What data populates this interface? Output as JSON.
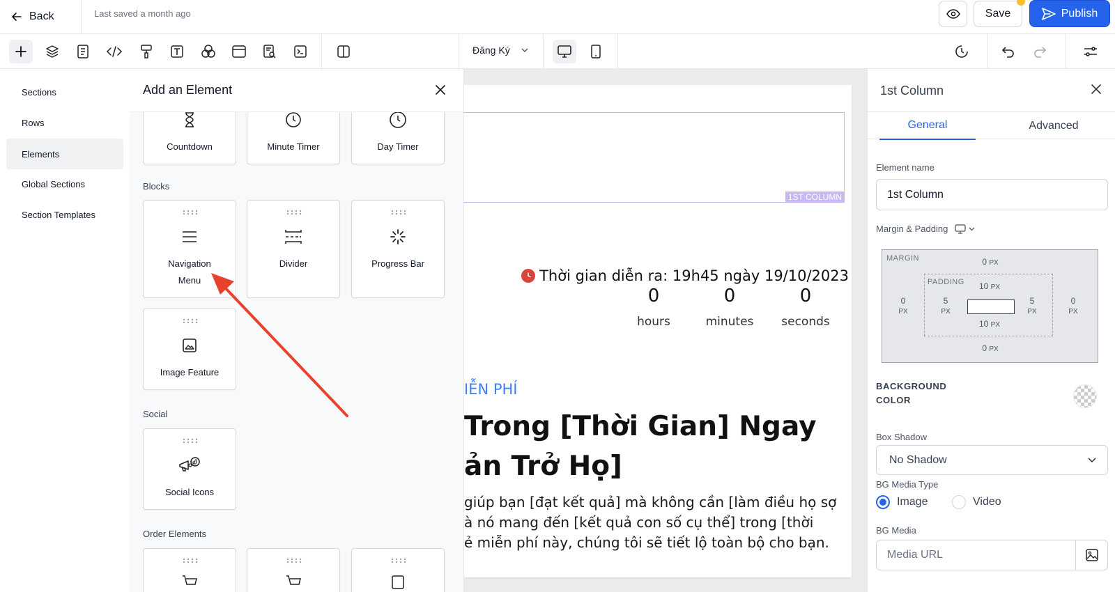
{
  "topbar": {
    "back_label": "Back",
    "last_saved": "Last saved a month ago",
    "save_label": "Save",
    "publish_label": "Publish",
    "colors": {
      "publish": "#2563eb",
      "notify": "#fbbf24"
    }
  },
  "toolbar": {
    "page_name": "Đăng Ký",
    "icons": [
      "plus-icon",
      "layers-icon",
      "page-icon",
      "code-icon",
      "paint-roller-icon",
      "text-icon",
      "shapes-icon",
      "layout-icon",
      "search-doc-icon",
      "terminal-icon",
      "columns-icon",
      "desktop-icon",
      "mobile-icon",
      "history-icon",
      "undo-icon",
      "redo-icon",
      "settings-sliders-icon"
    ]
  },
  "leftnav": {
    "items": [
      {
        "label": "Sections"
      },
      {
        "label": "Rows"
      },
      {
        "label": "Elements",
        "active": true
      },
      {
        "label": "Global Sections"
      },
      {
        "label": "Section Templates"
      }
    ]
  },
  "add_panel": {
    "title": "Add an Element",
    "top_row": [
      "Countdown",
      "Minute Timer",
      "Day Timer"
    ],
    "groups": {
      "blocks": "Blocks",
      "social": "Social",
      "order": "Order Elements"
    },
    "blocks": [
      {
        "line1": "Navigation",
        "line2": "Menu",
        "icon": "menu-icon"
      },
      {
        "line1": "Divider",
        "icon": "divider-icon"
      },
      {
        "line1": "Progress Bar",
        "icon": "spinner-icon"
      },
      {
        "line1": "Image Feature",
        "icon": "image-icon"
      }
    ],
    "social": [
      {
        "label": "Social Icons",
        "icon": "megaphone-like-icon"
      }
    ]
  },
  "canvas": {
    "column_tag": "1ST COLUMN",
    "event_text": "Thời gian diễn ra: 19h45 ngày 19/10/2023",
    "countdown": [
      {
        "num": "0",
        "unit": "hours"
      },
      {
        "num": "0",
        "unit": "minutes"
      },
      {
        "num": "0",
        "unit": "seconds"
      }
    ],
    "free_tag": "IỄN PHÍ",
    "headline_1": "Trong [Thời Gian] Ngay",
    "headline_2": "ản Trở Họ]",
    "body_1": "giúp bạn [đạt kết quả] mà không cần [làm điều họ sợ",
    "body_2": "à nó mang đến [kết quả con số cụ thể] trong [thời",
    "body_3": "ẻ miễn phí này, chúng tôi sẽ tiết lộ toàn bộ cho bạn."
  },
  "right_panel": {
    "title": "1st Column",
    "tabs": [
      "General",
      "Advanced"
    ],
    "element_name_label": "Element name",
    "element_name_value": "1st Column",
    "margin_padding_label": "Margin & Padding",
    "box": {
      "margin_label": "MARGIN",
      "padding_label": "PADDING",
      "margin_top": "0",
      "margin_bottom": "0",
      "margin_left": "0",
      "margin_right": "0",
      "padding_top": "10",
      "padding_bottom": "10",
      "padding_left": "5",
      "padding_right": "5",
      "unit": "PX"
    },
    "bg_color_label_1": "BACKGROUND",
    "bg_color_label_2": "COLOR",
    "box_shadow_label": "Box Shadow",
    "box_shadow_value": "No Shadow",
    "bg_media_type_label": "BG Media Type",
    "media_types": [
      "Image",
      "Video"
    ],
    "bg_media_label": "BG Media",
    "media_url_placeholder": "Media URL"
  }
}
